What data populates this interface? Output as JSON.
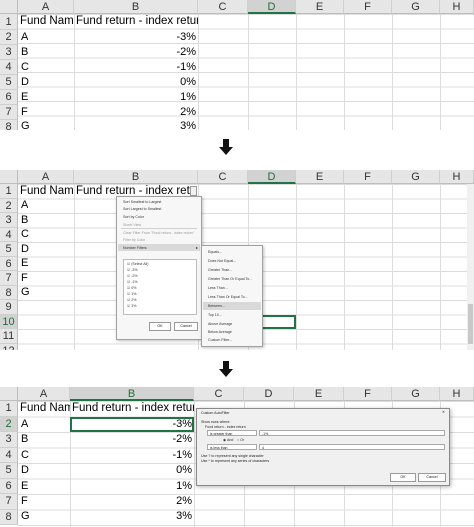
{
  "columns": [
    "A",
    "B",
    "C",
    "D",
    "E",
    "F",
    "G",
    "H"
  ],
  "headers": {
    "fund_name": "Fund Name",
    "fund_return": "Fund return - index return"
  },
  "funds": [
    {
      "name": "A",
      "value": "-3%"
    },
    {
      "name": "B",
      "value": "-2%"
    },
    {
      "name": "C",
      "value": "-1%"
    },
    {
      "name": "D",
      "value": "0%"
    },
    {
      "name": "E",
      "value": "1%"
    },
    {
      "name": "F",
      "value": "2%"
    },
    {
      "name": "G",
      "value": "3%"
    }
  ],
  "step2_rows": [
    "1",
    "2",
    "3",
    "4",
    "5",
    "6",
    "7",
    "8",
    "9",
    "10",
    "11",
    "12"
  ],
  "filter_menu": {
    "items": [
      "Sort Smallest to Largest",
      "Sort Largest to Smallest",
      "Sort by Color",
      "Sheet View",
      "Clear Filter From \"Fund return - index return\"",
      "Filter by Color",
      "Number Filters"
    ],
    "checklist": [
      "(Select All)",
      "-3%",
      "-2%",
      "-1%",
      "0%",
      "1%",
      "2%",
      "3%"
    ],
    "ok": "OK",
    "cancel": "Cancel"
  },
  "number_filters": [
    "Equals...",
    "Does Not Equal...",
    "Greater Than...",
    "Greater Than Or Equal To...",
    "Less Than...",
    "Less Than Or Equal To...",
    "Between...",
    "Top 10...",
    "Above Average",
    "Below Average",
    "Custom Filter..."
  ],
  "dialog": {
    "title": "Custom AutoFilter",
    "close": "✕",
    "intro": "Show rows where:",
    "field": "Fund return - index return",
    "op1": "is greater than",
    "val1": "-1%",
    "and": "And",
    "or": "Or",
    "op2": "is less than",
    "val2": "4",
    "hint1": "Use ? to represent any single character",
    "hint2": "Use * to represent any series of characters",
    "ok": "OK",
    "cancel": "Cancel"
  },
  "colors": {
    "accent": "#217346",
    "grid": "#dcdcdc",
    "header_bg": "#e6e6e6"
  }
}
